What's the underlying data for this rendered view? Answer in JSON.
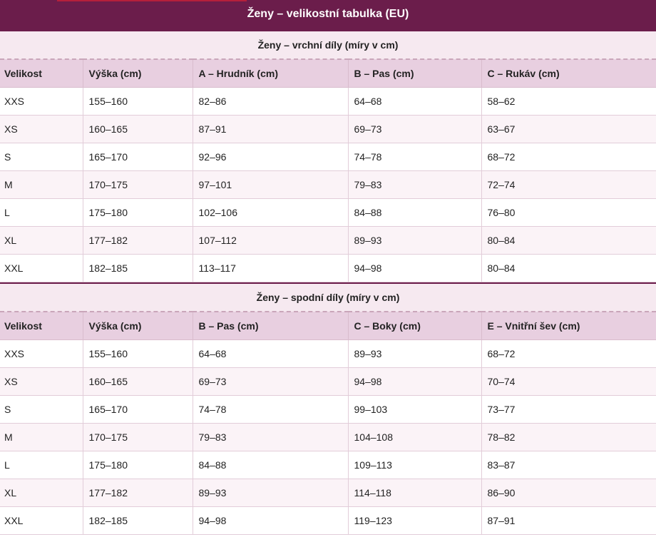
{
  "title": "Ženy – velikostní tabulka (EU)",
  "colors": {
    "header_bg": "#6b1d4b",
    "accent": "#b5203b",
    "section_bg": "#f6e9f0",
    "column_header_bg": "#e8cfe0",
    "row_alt_bg": "#fbf3f7"
  },
  "tops": {
    "title": "Ženy – vrchní díly (míry v cm)",
    "headers": [
      "Velikost",
      "Výška (cm)",
      "A – Hrudník (cm)",
      "B – Pas (cm)",
      "C – Rukáv (cm)"
    ],
    "rows": [
      [
        "XXS",
        "155–160",
        "82–86",
        "64–68",
        "58–62"
      ],
      [
        "XS",
        "160–165",
        "87–91",
        "69–73",
        "63–67"
      ],
      [
        "S",
        "165–170",
        "92–96",
        "74–78",
        "68–72"
      ],
      [
        "M",
        "170–175",
        "97–101",
        "79–83",
        "72–74"
      ],
      [
        "L",
        "175–180",
        "102–106",
        "84–88",
        "76–80"
      ],
      [
        "XL",
        "177–182",
        "107–112",
        "89–93",
        "80–84"
      ],
      [
        "XXL",
        "182–185",
        "113–117",
        "94–98",
        "80–84"
      ]
    ]
  },
  "bottoms": {
    "title": "Ženy – spodní díly (míry v cm)",
    "headers": [
      "Velikost",
      "Výška (cm)",
      "B – Pas (cm)",
      "C – Boky (cm)",
      "E – Vnitřní šev (cm)"
    ],
    "rows": [
      [
        "XXS",
        "155–160",
        "64–68",
        "89–93",
        "68–72"
      ],
      [
        "XS",
        "160–165",
        "69–73",
        "94–98",
        "70–74"
      ],
      [
        "S",
        "165–170",
        "74–78",
        "99–103",
        "73–77"
      ],
      [
        "M",
        "170–175",
        "79–83",
        "104–108",
        "78–82"
      ],
      [
        "L",
        "175–180",
        "84–88",
        "109–113",
        "83–87"
      ],
      [
        "XL",
        "177–182",
        "89–93",
        "114–118",
        "86–90"
      ],
      [
        "XXL",
        "182–185",
        "94–98",
        "119–123",
        "87–91"
      ]
    ]
  }
}
